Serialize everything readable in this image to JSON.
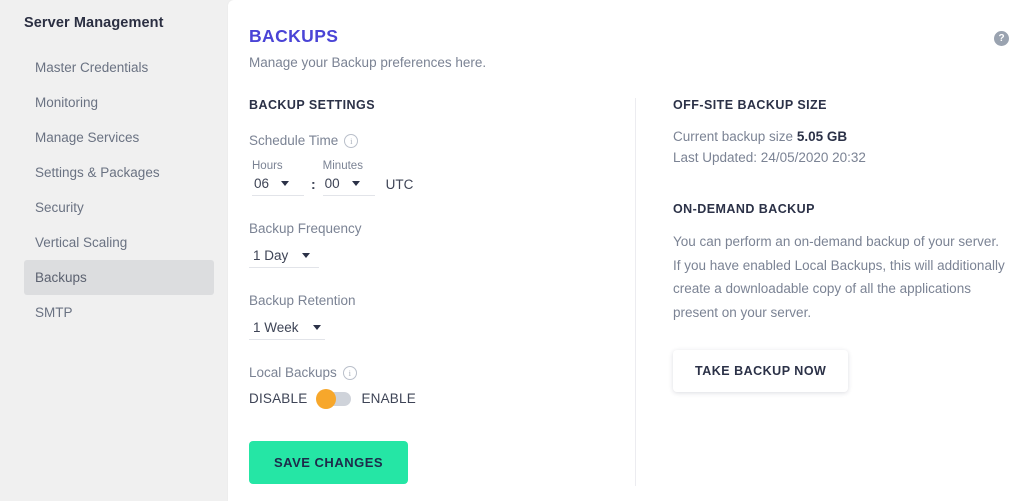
{
  "sidebar": {
    "title": "Server Management",
    "items": [
      {
        "label": "Master Credentials",
        "active": false
      },
      {
        "label": "Monitoring",
        "active": false
      },
      {
        "label": "Manage Services",
        "active": false
      },
      {
        "label": "Settings & Packages",
        "active": false
      },
      {
        "label": "Security",
        "active": false
      },
      {
        "label": "Vertical Scaling",
        "active": false
      },
      {
        "label": "Backups",
        "active": true
      },
      {
        "label": "SMTP",
        "active": false
      }
    ]
  },
  "header": {
    "title": "BACKUPS",
    "subtitle": "Manage your Backup preferences here.",
    "help_icon": "help-circle-icon",
    "help_glyph": "?"
  },
  "backup_settings": {
    "section_title": "BACKUP SETTINGS",
    "schedule": {
      "label": "Schedule Time",
      "info_icon": "info-icon",
      "info_glyph": "i",
      "hours_caption": "Hours",
      "hours_value": "06",
      "separator": ":",
      "minutes_caption": "Minutes",
      "minutes_value": "00",
      "timezone": "UTC"
    },
    "frequency": {
      "label": "Backup Frequency",
      "value": "1 Day"
    },
    "retention": {
      "label": "Backup Retention",
      "value": "1 Week"
    },
    "local_backups": {
      "label": "Local Backups",
      "info_icon": "info-icon",
      "info_glyph": "i",
      "off_label": "DISABLE",
      "on_label": "ENABLE",
      "state": "DISABLE"
    },
    "save_label": "SAVE CHANGES"
  },
  "offsite": {
    "section_title": "OFF-SITE BACKUP SIZE",
    "size_prefix": "Current backup size",
    "size_value": "5.05 GB",
    "last_updated": "Last Updated: 24/05/2020 20:32"
  },
  "ondemand": {
    "section_title": "ON-DEMAND BACKUP",
    "description": "You can perform an on-demand backup of your server. If you have enabled Local Backups, this will additionally create a downloadable copy of all the applications present on your server.",
    "button_label": "TAKE BACKUP NOW"
  },
  "colors": {
    "accent_title": "#4a44d6",
    "save_button": "#25e6a5",
    "toggle_knob": "#f7a72b",
    "page_background": "#f0f0f0",
    "sidebar_active": "#dcdddf"
  }
}
